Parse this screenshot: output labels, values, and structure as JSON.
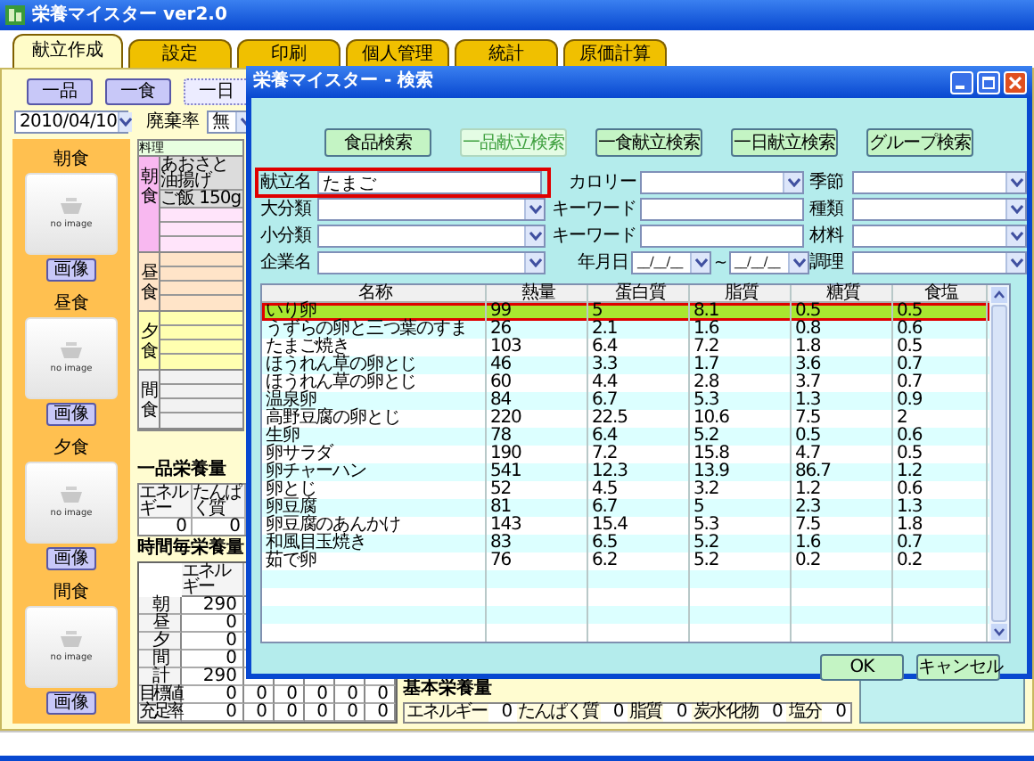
{
  "window": {
    "title": "栄養マイスター ver2.0"
  },
  "tabs": [
    {
      "label": "献立作成",
      "selected": true
    },
    {
      "label": "設定",
      "selected": false
    },
    {
      "label": "印刷",
      "selected": false
    },
    {
      "label": "個人管理",
      "selected": false
    },
    {
      "label": "統計",
      "selected": false
    },
    {
      "label": "原価計算",
      "selected": false
    }
  ],
  "mode_buttons": [
    {
      "label": "一品",
      "selected": false
    },
    {
      "label": "一食",
      "selected": false
    },
    {
      "label": "一日",
      "selected": true
    }
  ],
  "date": "2010/04/10",
  "waste_rate": {
    "label": "廃棄率",
    "value": "無"
  },
  "meal_images": [
    {
      "label": "朝食",
      "placeholder": "no image",
      "button": "画像"
    },
    {
      "label": "昼食",
      "placeholder": "no image",
      "button": "画像"
    },
    {
      "label": "夕食",
      "placeholder": "no image",
      "button": "画像"
    },
    {
      "label": "間食",
      "placeholder": "no image",
      "button": "画像"
    }
  ],
  "meal_grid": {
    "header": "料理",
    "sections": [
      {
        "label": "朝食",
        "kind": "breakfast",
        "dishes": [
          "あおさと油揚げ",
          "ご飯 150g"
        ]
      },
      {
        "label": "昼食",
        "kind": "lunch"
      },
      {
        "label": "夕食",
        "kind": "dinner"
      },
      {
        "label": "間食",
        "kind": "snack"
      }
    ]
  },
  "item_nutrition": {
    "title": "一品栄養量",
    "columns": [
      "エネルギー",
      "たんぱく質"
    ],
    "values": [
      "0",
      "0"
    ]
  },
  "time_nutrition": {
    "title": "時間毎栄養量",
    "columns": [
      "エネルギー"
    ],
    "rows": [
      {
        "label": "朝",
        "values": [
          "290"
        ]
      },
      {
        "label": "昼",
        "values": [
          "0"
        ]
      },
      {
        "label": "夕",
        "values": [
          "0"
        ]
      },
      {
        "label": "間",
        "values": [
          "0"
        ]
      },
      {
        "label": "計",
        "values": [
          "290"
        ]
      },
      {
        "label": "目標値",
        "values": [
          "0",
          "0",
          "0",
          "0",
          "0",
          "0"
        ]
      },
      {
        "label": "充足率",
        "values": [
          "0",
          "0",
          "0",
          "0",
          "0",
          "0"
        ]
      }
    ]
  },
  "basic_nutrition": {
    "title": "基本栄養量",
    "items": [
      {
        "label": "エネルギー",
        "value": "0"
      },
      {
        "label": "たんぱく質",
        "value": "0"
      },
      {
        "label": "脂質",
        "value": "0"
      },
      {
        "label": "炭水化物",
        "value": "0"
      },
      {
        "label": "塩分",
        "value": "0"
      }
    ]
  },
  "dialog": {
    "title": "栄養マイスター - 検索",
    "search_types": [
      {
        "label": "食品検索",
        "selected": false
      },
      {
        "label": "一品献立検索",
        "selected": true
      },
      {
        "label": "一食献立検索",
        "selected": false
      },
      {
        "label": "一日献立検索",
        "selected": false
      },
      {
        "label": "グループ検索",
        "selected": false
      }
    ],
    "fields": [
      {
        "label": "献立名",
        "kind": "text",
        "value": "たまご",
        "highlighted": true
      },
      {
        "label": "カロリー",
        "kind": "select",
        "highlighted": false
      },
      {
        "label": "季節",
        "kind": "select",
        "highlighted": false
      },
      {
        "label": "大分類",
        "kind": "select",
        "highlighted": false
      },
      {
        "label": "キーワード",
        "kind": "text",
        "highlighted": false
      },
      {
        "label": "種類",
        "kind": "select",
        "highlighted": false
      },
      {
        "label": "小分類",
        "kind": "select",
        "highlighted": false
      },
      {
        "label": "キーワード",
        "kind": "text",
        "highlighted": false
      },
      {
        "label": "材料",
        "kind": "select",
        "highlighted": false
      },
      {
        "label": "企業名",
        "kind": "select",
        "highlighted": false
      },
      {
        "label": "年月日",
        "kind": "date_range",
        "values": [
          "__/__/__",
          "__/__/__"
        ],
        "separator": "~",
        "highlighted": false
      },
      {
        "label": "調理",
        "kind": "select",
        "highlighted": false
      }
    ],
    "table": {
      "columns": [
        "名称",
        "熱量",
        "蛋白質",
        "脂質",
        "糖質",
        "食塩"
      ],
      "rows": [
        {
          "cells": [
            "いり卵",
            "99",
            "5",
            "8.1",
            "0.5",
            "0.5"
          ],
          "selected": true,
          "highlighted": true
        },
        {
          "cells": [
            "うずらの卵と三つ葉のすま",
            "26",
            "2.1",
            "1.6",
            "0.8",
            "0.6"
          ],
          "selected": false,
          "highlighted": false
        },
        {
          "cells": [
            "たまご焼き",
            "103",
            "6.4",
            "7.2",
            "1.8",
            "0.5"
          ],
          "selected": false,
          "highlighted": false
        },
        {
          "cells": [
            "ほうれん草の卵とじ",
            "46",
            "3.3",
            "1.7",
            "3.6",
            "0.7"
          ],
          "selected": false,
          "highlighted": false
        },
        {
          "cells": [
            "ほうれん草の卵とじ",
            "60",
            "4.4",
            "2.8",
            "3.7",
            "0.7"
          ],
          "selected": false,
          "highlighted": false
        },
        {
          "cells": [
            "温泉卵",
            "84",
            "6.7",
            "5.3",
            "1.3",
            "0.9"
          ],
          "selected": false,
          "highlighted": false
        },
        {
          "cells": [
            "高野豆腐の卵とじ",
            "220",
            "22.5",
            "10.6",
            "7.5",
            "2"
          ],
          "selected": false,
          "highlighted": false
        },
        {
          "cells": [
            "生卵",
            "78",
            "6.4",
            "5.2",
            "0.5",
            "0.6"
          ],
          "selected": false,
          "highlighted": false
        },
        {
          "cells": [
            "卵サラダ",
            "190",
            "7.2",
            "15.8",
            "4.7",
            "0.5"
          ],
          "selected": false,
          "highlighted": false
        },
        {
          "cells": [
            "卵チャーハン",
            "541",
            "12.3",
            "13.9",
            "86.7",
            "1.2"
          ],
          "selected": false,
          "highlighted": false
        },
        {
          "cells": [
            "卵とじ",
            "52",
            "4.5",
            "3.2",
            "1.2",
            "0.6"
          ],
          "selected": false,
          "highlighted": false
        },
        {
          "cells": [
            "卵豆腐",
            "81",
            "6.7",
            "5",
            "2.3",
            "1.3"
          ],
          "selected": false,
          "highlighted": false
        },
        {
          "cells": [
            "卵豆腐のあんかけ",
            "143",
            "15.4",
            "5.3",
            "7.5",
            "1.8"
          ],
          "selected": false,
          "highlighted": false
        },
        {
          "cells": [
            "和風目玉焼き",
            "83",
            "6.5",
            "5.2",
            "1.6",
            "0.7"
          ],
          "selected": false,
          "highlighted": false
        },
        {
          "cells": [
            "茹で卵",
            "76",
            "6.2",
            "5.2",
            "0.2",
            "0.2"
          ],
          "selected": false,
          "highlighted": false
        }
      ]
    },
    "buttons": [
      "OK",
      "キャンセル"
    ]
  }
}
